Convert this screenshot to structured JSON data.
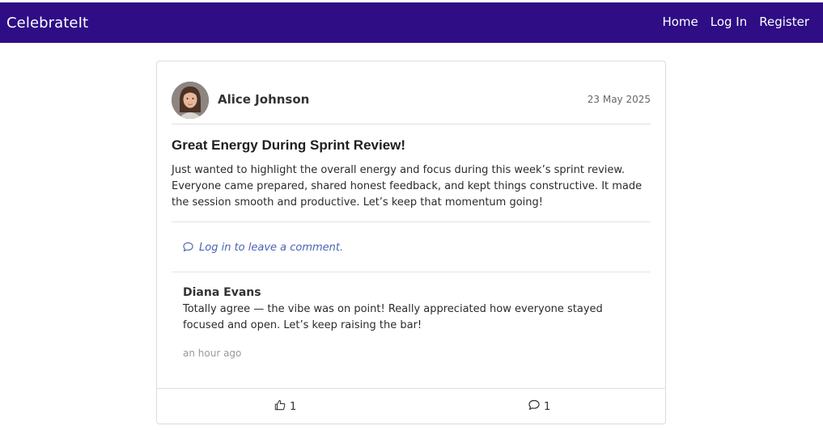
{
  "app": {
    "brand": "CelebrateIt"
  },
  "nav": {
    "home": "Home",
    "login": "Log In",
    "register": "Register"
  },
  "post": {
    "author": "Alice Johnson",
    "date": "23 May 2025",
    "title": "Great Energy During Sprint Review!",
    "body": "Just wanted to highlight the overall energy and focus during this week’s sprint review. Everyone came prepared, shared honest feedback, and kept things constructive. It made the session smooth and productive. Let’s keep that momentum going!",
    "login_prompt": "Log in to leave a comment.",
    "likes": "1",
    "comments_count": "1"
  },
  "comment": {
    "author": "Diana Evans",
    "text": "Totally agree — the vibe was on point! Really appreciated how everyone stayed focused and open. Let’s keep raising the bar!",
    "time": "an hour ago"
  },
  "icons": {
    "like": "thumbs-up-icon",
    "comment": "chat-bubble-icon",
    "avatar": "user-avatar"
  },
  "colors": {
    "navbar": "#2e0d85",
    "link": "#4a63b5"
  }
}
